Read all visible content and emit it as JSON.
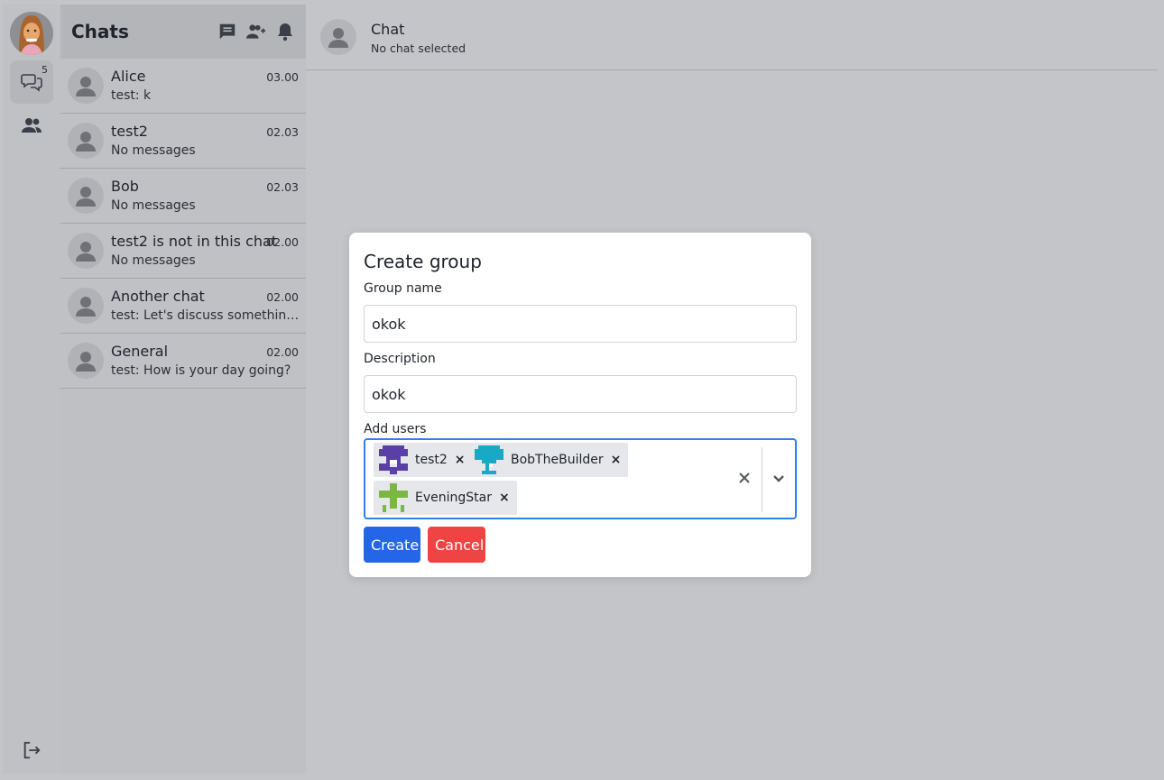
{
  "rail": {
    "chats_badge": "5"
  },
  "list": {
    "title": "Chats",
    "items": [
      {
        "name": "Alice",
        "time": "03.00",
        "preview": "test: k"
      },
      {
        "name": "test2",
        "time": "02.03",
        "preview": "No messages"
      },
      {
        "name": "Bob",
        "time": "02.03",
        "preview": "No messages"
      },
      {
        "name": "test2 is not in this chat",
        "time": "02.00",
        "preview": "No messages"
      },
      {
        "name": "Another chat",
        "time": "02.00",
        "preview": "test: Let's discuss something in..."
      },
      {
        "name": "General",
        "time": "02.00",
        "preview": "test: How is your day going?"
      }
    ]
  },
  "main": {
    "title": "Chat",
    "subtitle": "No chat selected"
  },
  "modal": {
    "title": "Create group",
    "group_name_label": "Group name",
    "group_name_value": "okok",
    "description_label": "Description",
    "description_value": "okok",
    "add_users_label": "Add users",
    "selected_users": [
      {
        "name": "test2",
        "avatar_color": "#5b3fa8"
      },
      {
        "name": "BobTheBuilder",
        "avatar_color": "#19a9c4"
      },
      {
        "name": "EveningStar",
        "avatar_color": "#7bb843"
      }
    ],
    "remove_glyph": "×",
    "create_label": "Create",
    "cancel_label": "Cancel"
  },
  "colors": {
    "primary": "#2566e8",
    "danger": "#ef4444",
    "focus": "#2f80ed"
  }
}
